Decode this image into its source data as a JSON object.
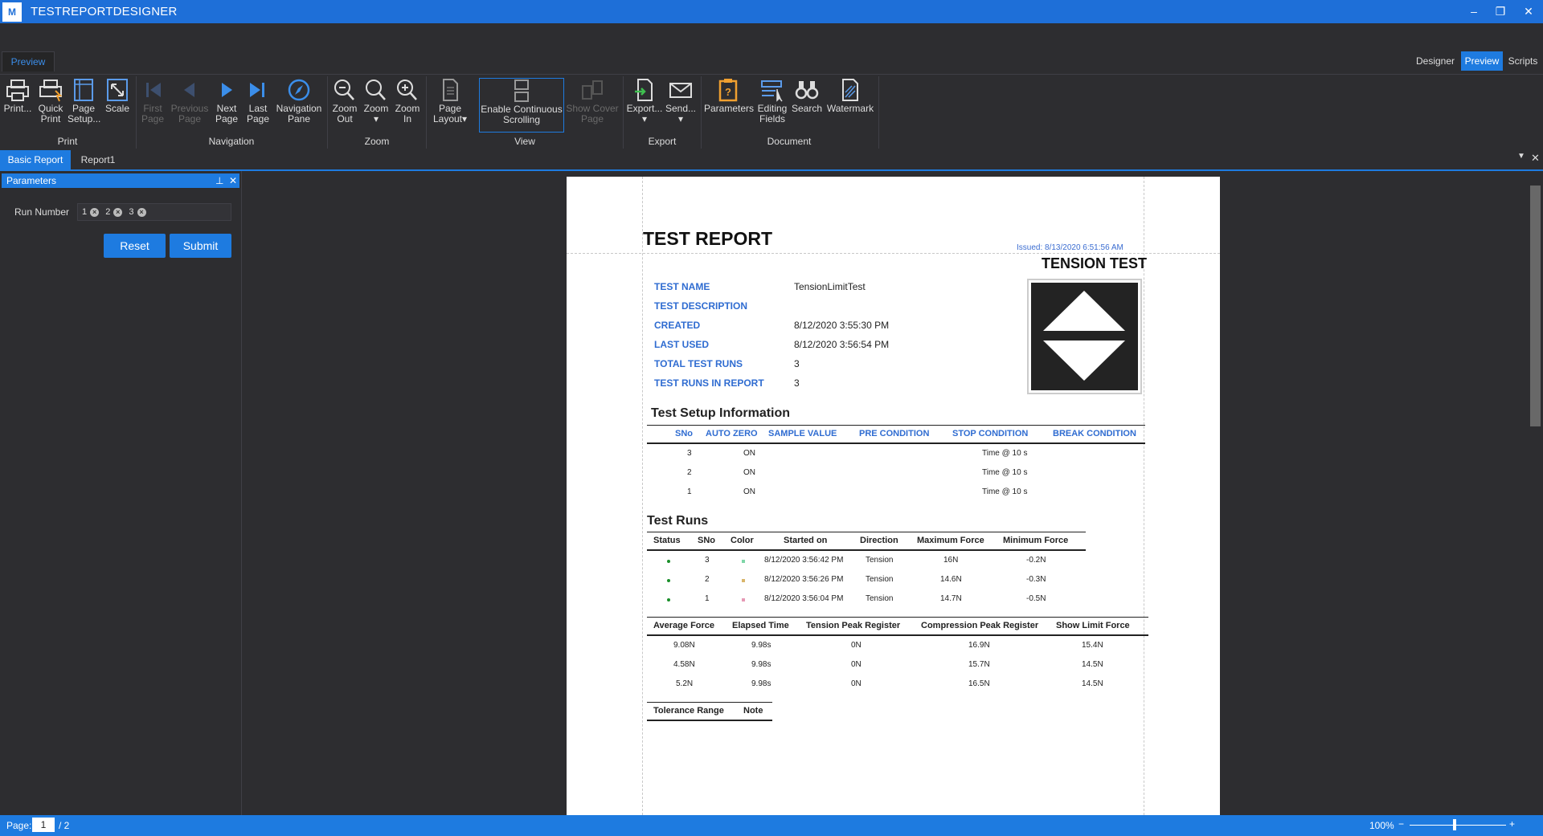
{
  "app": {
    "title": "TESTREPORTDESIGNER",
    "logo_text": "M"
  },
  "ribbon_tabs": {
    "left_tab": "Preview",
    "designer": "Designer",
    "preview": "Preview",
    "scripts": "Scripts"
  },
  "ribbon": {
    "print": "Print...",
    "quick_print_1": "Quick",
    "quick_print_2": "Print",
    "page_setup_1": "Page",
    "page_setup_2": "Setup...",
    "scale": "Scale",
    "first_page_1": "First",
    "first_page_2": "Page",
    "previous_page_1": "Previous",
    "previous_page_2": "Page",
    "next_page_1": "Next",
    "next_page_2": "Page",
    "last_page_1": "Last",
    "last_page_2": "Page",
    "nav_pane_1": "Navigation",
    "nav_pane_2": "Pane",
    "zoom_out_1": "Zoom",
    "zoom_out_2": "Out",
    "zoom": "Zoom",
    "zoom_in_1": "Zoom",
    "zoom_in_2": "In",
    "page_layout_1": "Page",
    "page_layout_2": "Layout",
    "continuous_1": "Enable Continuous",
    "continuous_2": "Scrolling",
    "cover_1": "Show Cover",
    "cover_2": "Page",
    "export": "Export...",
    "send": "Send...",
    "parameters": "Parameters",
    "editing_1": "Editing",
    "editing_2": "Fields",
    "search": "Search",
    "watermark": "Watermark",
    "groups": {
      "print": "Print",
      "navigation": "Navigation",
      "zoom": "Zoom",
      "view": "View",
      "export": "Export",
      "document": "Document"
    }
  },
  "doc_tabs": {
    "basic": "Basic Report",
    "report1": "Report1"
  },
  "parameters_panel": {
    "title": "Parameters",
    "run_number_label": "Run Number",
    "tokens": [
      "1",
      "2",
      "3"
    ],
    "reset": "Reset",
    "submit": "Submit"
  },
  "report": {
    "title": "TEST REPORT",
    "issued": "Issued: 8/13/2020 6:51:56 AM",
    "test_type": "TENSION TEST",
    "info": [
      {
        "label": "TEST NAME",
        "value": "TensionLimitTest"
      },
      {
        "label": "TEST DESCRIPTION",
        "value": ""
      },
      {
        "label": "CREATED",
        "value": "8/12/2020 3:55:30 PM"
      },
      {
        "label": "LAST USED",
        "value": "8/12/2020 3:56:54 PM"
      },
      {
        "label": "TOTAL TEST RUNS",
        "value": "3"
      },
      {
        "label": "TEST RUNS IN REPORT",
        "value": "3"
      }
    ],
    "setup_title": "Test Setup Information",
    "setup_headers": [
      "SNo",
      "AUTO ZERO",
      "SAMPLE VALUE",
      "PRE CONDITION",
      "STOP CONDITION",
      "BREAK CONDITION"
    ],
    "setup_rows": [
      [
        "3",
        "ON",
        "",
        "",
        "Time @ 10 s",
        ""
      ],
      [
        "2",
        "ON",
        "",
        "",
        "Time @ 10 s",
        ""
      ],
      [
        "1",
        "ON",
        "",
        "",
        "Time @ 10 s",
        ""
      ]
    ],
    "runs_title": "Test Runs",
    "runs_headers": [
      "Status",
      "SNo",
      "Color",
      "Started on",
      "Direction",
      "Maximum Force",
      "Minimum Force"
    ],
    "runs_rows": [
      [
        "",
        "3",
        "",
        "8/12/2020 3:56:42 PM",
        "Tension",
        "16N",
        "-0.2N"
      ],
      [
        "",
        "2",
        "",
        "8/12/2020 3:56:26 PM",
        "Tension",
        "14.6N",
        "-0.3N"
      ],
      [
        "",
        "1",
        "",
        "8/12/2020 3:56:04 PM",
        "Tension",
        "14.7N",
        "-0.5N"
      ]
    ],
    "run_colors": [
      "#7fd6a8",
      "#d9b56a",
      "#e69ab5"
    ],
    "force_headers": [
      "Average Force",
      "Elapsed Time",
      "Tension Peak Register",
      "Compression Peak Register",
      "Show Limit Force"
    ],
    "force_rows": [
      [
        "9.08N",
        "9.98s",
        "0N",
        "16.9N",
        "15.4N"
      ],
      [
        "4.58N",
        "9.98s",
        "0N",
        "15.7N",
        "14.5N"
      ],
      [
        "5.2N",
        "9.98s",
        "0N",
        "16.5N",
        "14.5N"
      ]
    ],
    "tolerance_headers": [
      "Tolerance Range",
      "Note"
    ]
  },
  "status": {
    "page_label": "Page:",
    "page": "1",
    "total": "/ 2",
    "zoom": "100%",
    "zoom_minus": "−",
    "zoom_plus": "+"
  },
  "colors": {
    "accent": "#1e7be0",
    "label_blue": "#2f6cd1",
    "status_green": "#1a8f2a"
  }
}
